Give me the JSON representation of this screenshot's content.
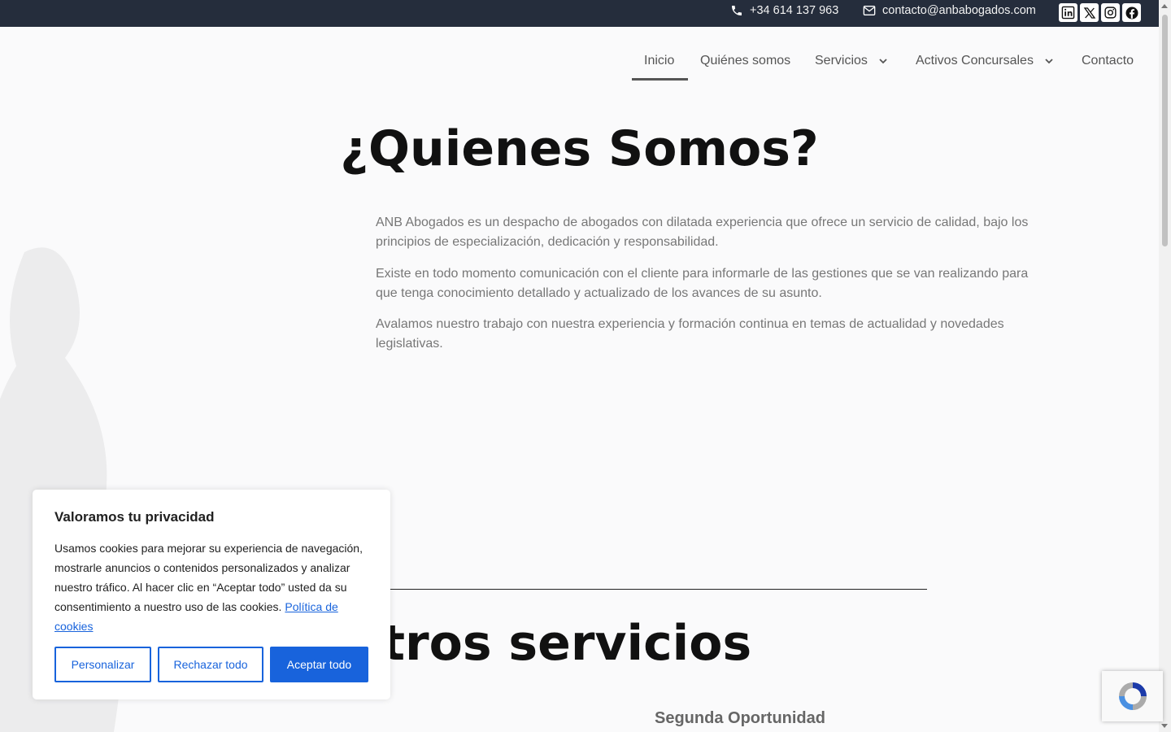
{
  "topbar": {
    "phone": "+34 614 137 963",
    "email": "contacto@anbabogados.com",
    "socials": [
      "linkedin-icon",
      "x-icon",
      "instagram-icon",
      "facebook-icon"
    ]
  },
  "nav": {
    "items": [
      {
        "label": "Inicio",
        "active": true
      },
      {
        "label": "Quiénes somos"
      },
      {
        "label": "Servicios",
        "dropdown": true
      },
      {
        "label": "Activos Concursales",
        "dropdown": true
      },
      {
        "label": "Contacto"
      }
    ]
  },
  "hero": {
    "title": "¿Quienes Somos?",
    "paragraphs": [
      "ANB Abogados es un despacho de abogados con dilatada experiencia que ofrece un servicio de calidad, bajo los principios de especialización, dedicación y responsabilidad.",
      "Existe en todo momento comunicación con el cliente para informarle de las gestiones que se van realizando para que tenga conocimiento detallado y actualizado de los avances de su asunto.",
      "Avalamos nuestro trabajo con nuestra experiencia y formación continua en temas de actualidad y novedades legislativas."
    ]
  },
  "services": {
    "title": "Nuestros servicios",
    "first_item": "Segunda Oportunidad"
  },
  "cookie": {
    "title": "Valoramos tu privacidad",
    "text": "Usamos cookies para mejorar su experiencia de navegación, mostrarle anuncios o contenidos personalizados y analizar nuestro tráfico. Al hacer clic en “Aceptar todo” usted da su consentimiento a nuestro uso de las cookies.",
    "policy_link": "Política de cookies",
    "buttons": {
      "customize": "Personalizar",
      "reject": "Rechazar todo",
      "accept": "Aceptar todo"
    }
  },
  "colors": {
    "topbar_bg": "#252d3c",
    "cookie_accent": "#1863dc"
  }
}
